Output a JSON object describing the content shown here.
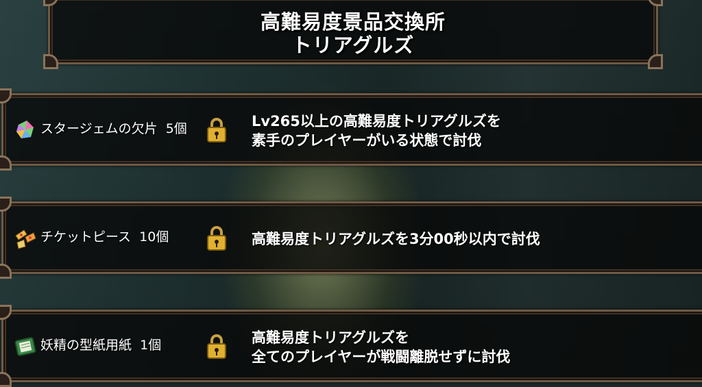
{
  "header": {
    "title_line1": "高難易度景品交換所",
    "title_line2": "トリアグルズ"
  },
  "rewards": [
    {
      "icon": "star-gem-fragment-icon",
      "label": "スタージェムの欠片",
      "count": "5個",
      "locked": true,
      "condition_lines": [
        "Lv265以上の高難易度トリアグルズを",
        "素手のプレイヤーがいる状態で討伐"
      ]
    },
    {
      "icon": "ticket-piece-icon",
      "label": "チケットピース",
      "count": "10個",
      "locked": true,
      "condition_lines": [
        "高難易度トリアグルズを3分00秒以内で討伐"
      ]
    },
    {
      "icon": "fairy-mold-paper-icon",
      "label": "妖精の型紙用紙",
      "count": "1個",
      "locked": true,
      "condition_lines": [
        "高難易度トリアグルズを",
        "全てのプレイヤーが戦闘離脱せずに討伐"
      ]
    }
  ],
  "colors": {
    "frame": "#6e5a46",
    "panel_bg": "#080808",
    "lock_gold": "#e0b030",
    "text": "#ffffff"
  }
}
